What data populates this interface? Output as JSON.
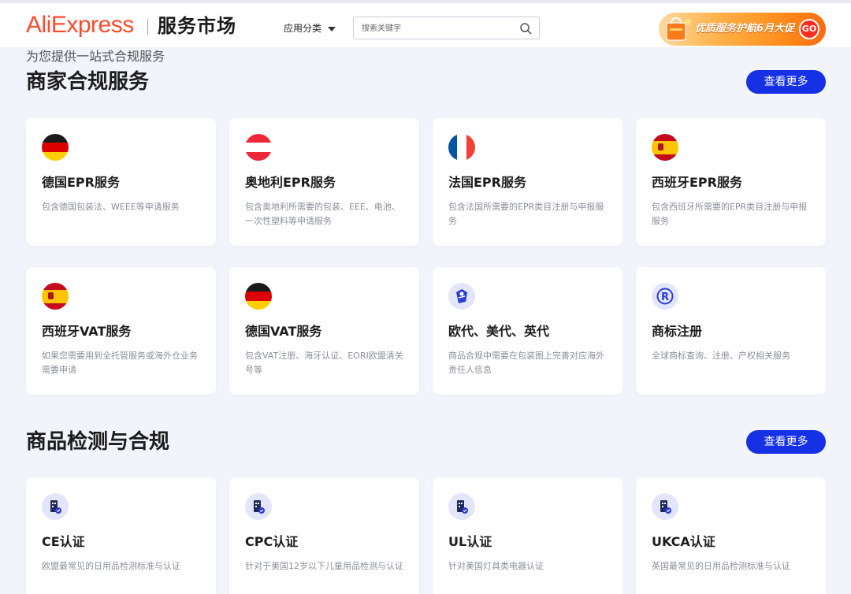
{
  "header": {
    "logo": "AliExpress",
    "logo_sub": "服务市场",
    "category_menu": "应用分类",
    "search_placeholder": "搜索关键字",
    "promo_text": "优质服务护航6月大促",
    "promo_go": "GO"
  },
  "intro": {
    "subtitle": "为您提供一站式合规服务"
  },
  "sections": [
    {
      "title": "商家合规服务",
      "more_label": "查看更多",
      "cards": [
        {
          "icon": "germany-flag-icon",
          "title": "德国EPR服务",
          "desc": "包含德国包装法、WEEE等申请服务"
        },
        {
          "icon": "austria-flag-icon",
          "title": "奥地利EPR服务",
          "desc": "包含奥地利所需要的包装、EEE、电池、一次性塑料等申请服务"
        },
        {
          "icon": "france-flag-icon",
          "title": "法国EPR服务",
          "desc": "包含法国所需要的EPR类目注册与申报服务"
        },
        {
          "icon": "spain-flag-icon",
          "title": "西班牙EPR服务",
          "desc": "包含西班牙所需要的EPR类目注册与申报服务"
        },
        {
          "icon": "spain-flag-icon",
          "title": "西班牙VAT服务",
          "desc": "如果您需要用到全托管服务或海外仓业务需要申请"
        },
        {
          "icon": "germany-flag-icon",
          "title": "德国VAT服务",
          "desc": "包含VAT注册、海牙认证、EORI欧盟清关号等"
        },
        {
          "icon": "representative-icon",
          "title": "欧代、美代、英代",
          "desc": "商品合规中需要在包装图上完善对应海外责任人信息"
        },
        {
          "icon": "trademark-icon",
          "title": "商标注册",
          "desc": "全球商标查询、注册、产权相关服务"
        }
      ]
    },
    {
      "title": "商品检测与合规",
      "more_label": "查看更多",
      "cards": [
        {
          "icon": "certification-icon",
          "title": "CE认证",
          "desc": "欧盟最常见的日用品检测标准与认证"
        },
        {
          "icon": "certification-icon",
          "title": "CPC认证",
          "desc": "针对于美国12岁以下儿童用品检测与认证"
        },
        {
          "icon": "certification-icon",
          "title": "UL认证",
          "desc": "针对美国灯具类电器认证"
        },
        {
          "icon": "certification-icon",
          "title": "UKCA认证",
          "desc": "英国最常见的日用品检测标准与认证"
        }
      ]
    }
  ],
  "colors": {
    "brand_red": "#ff4b2b",
    "accent_blue": "#1630e6",
    "page_bg": "#f1f4fb"
  }
}
